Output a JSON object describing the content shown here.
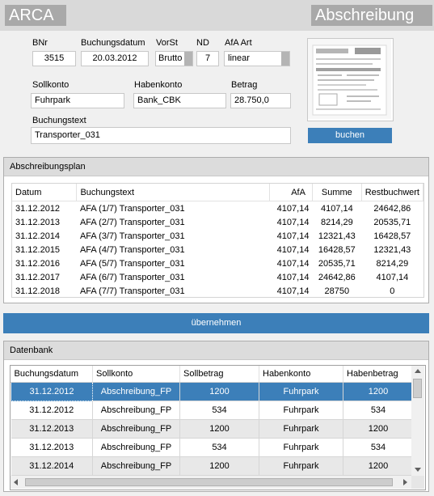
{
  "header": {
    "app_title": "ARCA",
    "page_title": "Abschreibung"
  },
  "form": {
    "bnr": {
      "label": "BNr",
      "value": "3515"
    },
    "buchungsdatum": {
      "label": "Buchungsdatum",
      "value": "20.03.2012"
    },
    "vorst": {
      "label": "VorSt",
      "value": "Brutto"
    },
    "nd": {
      "label": "ND",
      "value": "7"
    },
    "afa_art": {
      "label": "AfA Art",
      "value": "linear"
    },
    "sollkonto": {
      "label": "Sollkonto",
      "value": "Fuhrpark"
    },
    "habenkonto": {
      "label": "Habenkonto",
      "value": "Bank_CBK"
    },
    "betrag": {
      "label": "Betrag",
      "value": "28.750,0"
    },
    "buchungstext": {
      "label": "Buchungstext",
      "value": "Transporter_031"
    },
    "buchen_label": "buchen"
  },
  "plan": {
    "title": "Abschreibungsplan",
    "columns": [
      "Datum",
      "Buchungstext",
      "AfA",
      "Summe",
      "Restbuchwert"
    ],
    "rows": [
      [
        "31.12.2012",
        "AFA (1/7) Transporter_031",
        "4107,14",
        "4107,14",
        "24642,86"
      ],
      [
        "31.12.2013",
        "AFA (2/7) Transporter_031",
        "4107,14",
        "8214,29",
        "20535,71"
      ],
      [
        "31.12.2014",
        "AFA (3/7) Transporter_031",
        "4107,14",
        "12321,43",
        "16428,57"
      ],
      [
        "31.12.2015",
        "AFA (4/7) Transporter_031",
        "4107,14",
        "16428,57",
        "12321,43"
      ],
      [
        "31.12.2016",
        "AFA (5/7) Transporter_031",
        "4107,14",
        "20535,71",
        "8214,29"
      ],
      [
        "31.12.2017",
        "AFA (6/7) Transporter_031",
        "4107,14",
        "24642,86",
        "4107,14"
      ],
      [
        "31.12.2018",
        "AFA (7/7) Transporter_031",
        "4107,14",
        "28750",
        "0"
      ]
    ]
  },
  "uebernehmen_label": "übernehmen",
  "db": {
    "title": "Datenbank",
    "columns": [
      "Buchungsdatum",
      "Sollkonto",
      "Sollbetrag",
      "Habenkonto",
      "Habenbetrag"
    ],
    "rows": [
      [
        "31.12.2012",
        "Abschreibung_FP",
        "1200",
        "Fuhrpark",
        "1200"
      ],
      [
        "31.12.2012",
        "Abschreibung_FP",
        "534",
        "Fuhrpark",
        "534"
      ],
      [
        "31.12.2013",
        "Abschreibung_FP",
        "1200",
        "Fuhrpark",
        "1200"
      ],
      [
        "31.12.2013",
        "Abschreibung_FP",
        "534",
        "Fuhrpark",
        "534"
      ],
      [
        "31.12.2014",
        "Abschreibung_FP",
        "1200",
        "Fuhrpark",
        "1200"
      ]
    ],
    "selected_row": 0
  },
  "icons": {
    "receipt_image": "receipt-thumbnail"
  },
  "colors": {
    "accent": "#3c7fb9",
    "title_box": "#a9a9a9"
  }
}
